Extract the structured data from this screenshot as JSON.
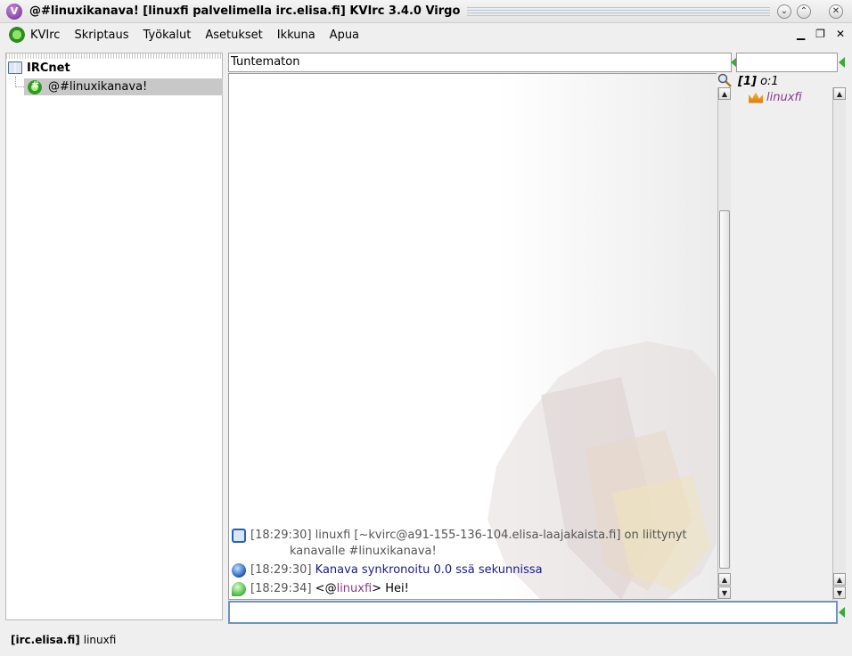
{
  "window": {
    "title": "@#linuxikanava! [linuxfi palvelimella irc.elisa.fi] KVIrc 3.4.0 Virgo",
    "logo_letter": "V"
  },
  "menu": {
    "items": [
      "KVIrc",
      "Skriptaus",
      "Työkalut",
      "Asetukset",
      "Ikkuna",
      "Apua"
    ]
  },
  "tree": {
    "network": "IRCnet",
    "channel": "@#linuxikanava!"
  },
  "topic": {
    "text": "Tuntematon"
  },
  "userlist": {
    "count_label": "[1]",
    "ops_label": "o:1",
    "users": [
      "linuxfi"
    ]
  },
  "chat": {
    "messages": [
      {
        "type": "join",
        "time": "[18:29:30]",
        "text": "linuxfi [~kvirc@a91-155-136-104.elisa-laajakaista.fi] on liittynyt",
        "continuation": "kanavalle #linuxikanava!"
      },
      {
        "type": "info",
        "time": "[18:29:30]",
        "text": "Kanava synkronoitu 0.0 ssä sekunnissa"
      },
      {
        "type": "message",
        "time": "[18:29:34]",
        "prefix": "<@",
        "nick": "linuxfi",
        "suffix": ">",
        "text": "Hei!"
      }
    ]
  },
  "input": {
    "value": ""
  },
  "status": {
    "server": "[irc.elisa.fi]",
    "nick": "linuxfi"
  },
  "colors": {
    "nick": "#8a3a8a",
    "info": "#1a1a8a",
    "input_border": "#6d93c4",
    "selection": "#c8c8c8"
  }
}
